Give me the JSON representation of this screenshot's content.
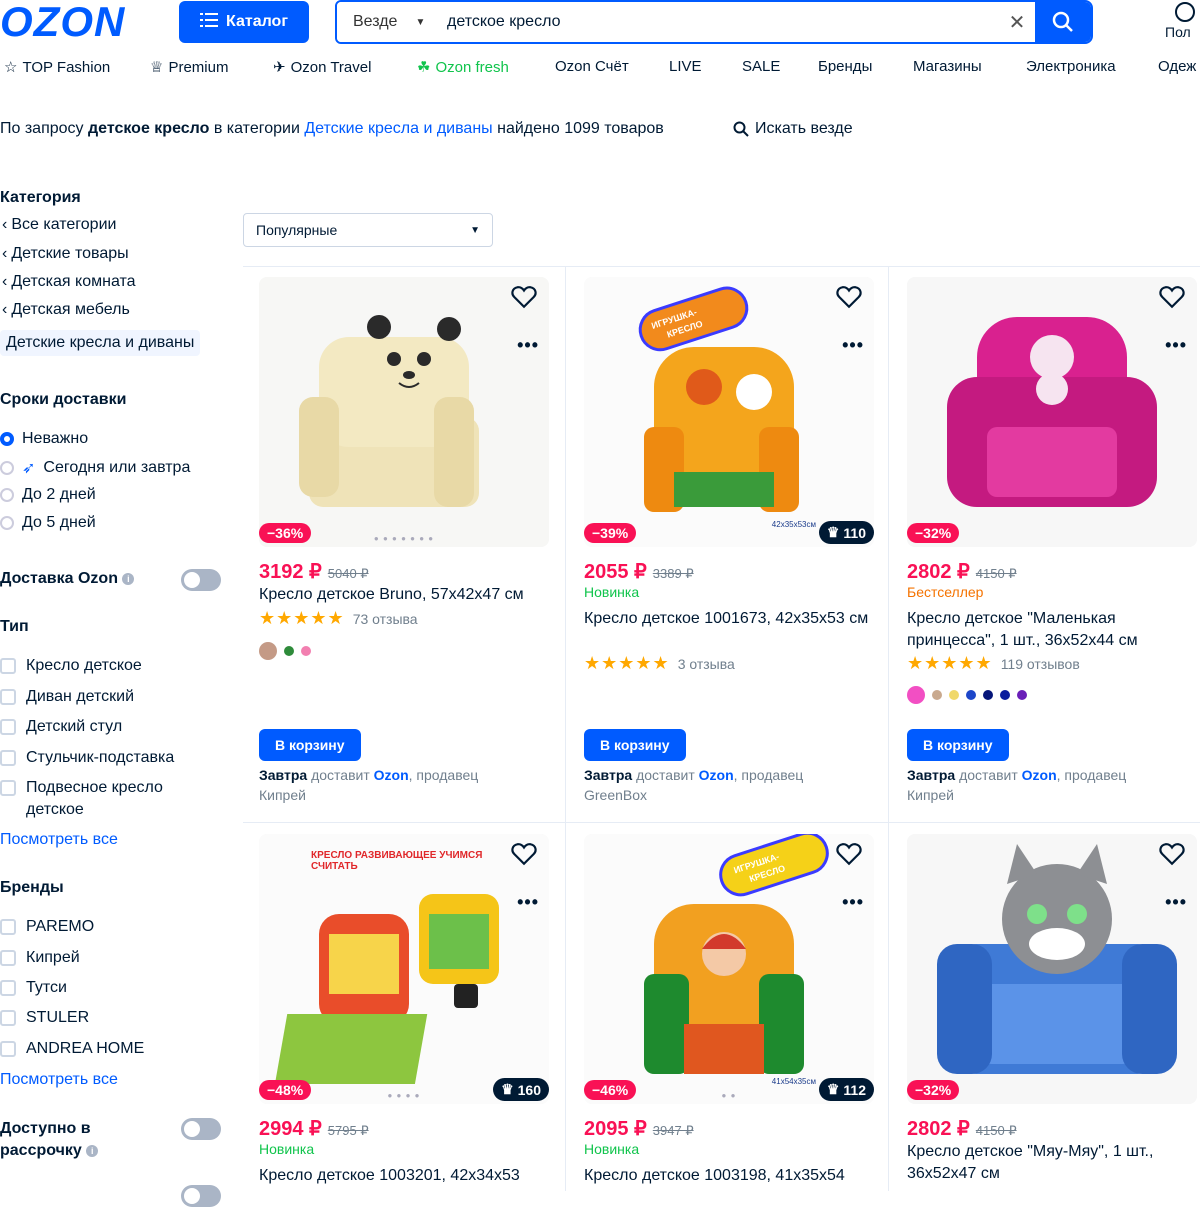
{
  "header": {
    "logo": "OZON",
    "catalog_label": "Каталог",
    "search_scope": "Везде",
    "search_value": "детское кресло",
    "login_label": "Пол"
  },
  "nav": [
    {
      "label": "TOP Fashion",
      "icon": "star-icon"
    },
    {
      "label": "Premium",
      "icon": "crown-icon"
    },
    {
      "label": "Ozon Travel",
      "icon": "plane-icon"
    },
    {
      "label": "Ozon fresh",
      "icon": "leaf-icon",
      "color": "#10c44c"
    },
    {
      "label": "Ozon Счёт"
    },
    {
      "label": "LIVE"
    },
    {
      "label": "SALE"
    },
    {
      "label": "Бренды"
    },
    {
      "label": "Магазины"
    },
    {
      "label": "Электроника"
    },
    {
      "label": "Одеж"
    }
  ],
  "query": {
    "prefix": "По запросу",
    "term": "детское кресло",
    "mid": "в категории",
    "category": "Детские кресла и диваны",
    "suffix": "найдено 1099 товаров",
    "search_all": "Искать везде"
  },
  "sidebar": {
    "category_title": "Категория",
    "categories": [
      "Все категории",
      "Детские товары",
      "Детская комната",
      "Детская мебель"
    ],
    "active_category": "Детские кресла и диваны",
    "delivery_title": "Сроки доставки",
    "delivery_options": [
      "Неважно",
      "Сегодня или завтра",
      "До 2 дней",
      "До 5 дней"
    ],
    "ozon_delivery_label": "Доставка Ozon",
    "type_title": "Тип",
    "types": [
      "Кресло детское",
      "Диван детский",
      "Детский стул",
      "Стульчик-подставка",
      "Подвесное кресло детское"
    ],
    "show_all": "Посмотреть все",
    "brands_title": "Бренды",
    "brands": [
      "PAREMO",
      "Кипрей",
      "Тутси",
      "STULER",
      "ANDREA HOME"
    ],
    "installment_label": "Доступно в рассрочку"
  },
  "sort": {
    "selected": "Популярные"
  },
  "products": [
    {
      "discount": "−36%",
      "price": "3192 ₽",
      "old_price": "5040 ₽",
      "badge": "",
      "title": "Кресло детское Bruno, 57x42x47 см",
      "reviews": "73 отзыва",
      "cart": "В корзину",
      "delivery_day": "Завтра",
      "delivery_mid": "доставит",
      "delivery_by": "Ozon",
      "seller_prefix": ", продавец",
      "seller": "Кипрей",
      "crown": "",
      "swatches": [
        "#c49a86",
        "#2e8b3a",
        "#f27fb0"
      ]
    },
    {
      "discount": "−39%",
      "price": "2055 ₽",
      "old_price": "3389 ₽",
      "badge": "Новинка",
      "title": "Кресло детское 1001673, 42x35x53 см",
      "reviews": "3 отзыва",
      "cart": "В корзину",
      "delivery_day": "Завтра",
      "delivery_mid": "доставит",
      "delivery_by": "Ozon",
      "seller_prefix": ", продавец",
      "seller": "GreenBox",
      "crown": "110",
      "size_label": "42x35x53см",
      "swatches": []
    },
    {
      "discount": "−32%",
      "price": "2802 ₽",
      "old_price": "4150 ₽",
      "badge": "Бестселлер",
      "title": "Кресло детское \"Маленькая принцесса\", 1 шт., 36x52x44 см",
      "reviews": "119 отзывов",
      "cart": "В корзину",
      "delivery_day": "Завтра",
      "delivery_mid": "доставит",
      "delivery_by": "Ozon",
      "seller_prefix": ", продавец",
      "seller": "Кипрей",
      "crown": "",
      "swatches": [
        "#f24fc3",
        "#c9a98e",
        "#f0d86a",
        "#1d46c9",
        "#06167a",
        "#0a1c9e",
        "#6a1fb8"
      ]
    },
    {
      "discount": "−48%",
      "price": "2994 ₽",
      "old_price": "5795 ₽",
      "badge": "Новинка",
      "title": "Кресло детское 1003201, 42x34x53",
      "crown": "160",
      "img_text": "КРЕСЛО РАЗВИВАЮЩЕЕ УЧИМСЯ СЧИТАТЬ"
    },
    {
      "discount": "−46%",
      "price": "2095 ₽",
      "old_price": "3947 ₽",
      "badge": "Новинка",
      "title": "Кресло детское 1003198, 41x35x54",
      "crown": "112",
      "size_label": "41x54x35см"
    },
    {
      "discount": "−32%",
      "price": "2802 ₽",
      "old_price": "4150 ₽",
      "badge": "",
      "title": "Кресло детское \"Мяу-Мяу\", 1 шт., 36x52x47 см",
      "crown": ""
    }
  ],
  "sticker_text": "ИГРУШКА-КРЕСЛО",
  "colors": {
    "brand": "#005bff",
    "price": "#f91155",
    "new": "#10c44c",
    "bestseller": "#f57300"
  }
}
